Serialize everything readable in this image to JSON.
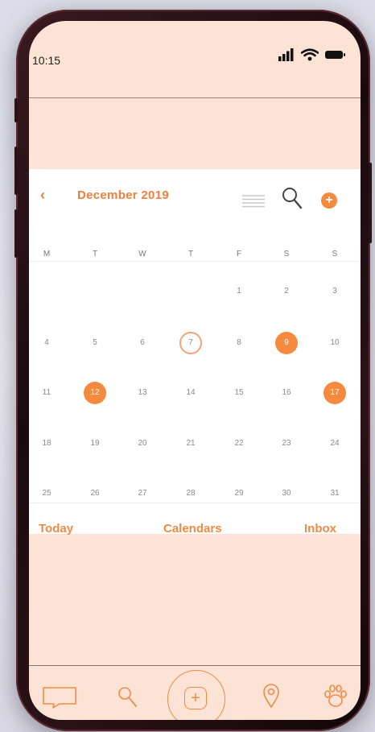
{
  "status": {
    "time": "10:15"
  },
  "calendar": {
    "month_label": "December 2019",
    "weekdays": [
      "M",
      "T",
      "W",
      "T",
      "F",
      "S",
      "S"
    ],
    "rows": [
      [
        "",
        "",
        "",
        "",
        "1",
        "2",
        "3"
      ],
      [
        "4",
        "5",
        "6",
        "7",
        "8",
        "9",
        "10"
      ],
      [
        "11",
        "12",
        "13",
        "14",
        "15",
        "16",
        "17"
      ],
      [
        "18",
        "19",
        "20",
        "21",
        "22",
        "23",
        "24"
      ],
      [
        "25",
        "26",
        "27",
        "28",
        "29",
        "30",
        "31"
      ]
    ],
    "today": "7",
    "highlighted": [
      "9",
      "12",
      "17"
    ]
  },
  "footer": {
    "today_label": "Today",
    "calendars_label": "Calendars",
    "inbox_label": "Inbox"
  },
  "colors": {
    "accent": "#f58a3f",
    "screen_bg": "#fde3d6",
    "card_bg": "#ffffff"
  },
  "nav_icons": [
    "chat-icon",
    "search-icon",
    "add-icon",
    "location-pin-icon",
    "paw-icon"
  ]
}
